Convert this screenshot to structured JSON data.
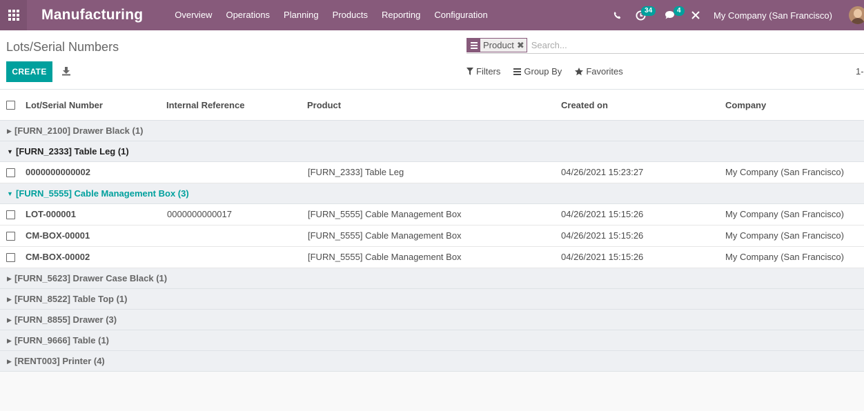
{
  "navbar": {
    "brand": "Manufacturing",
    "menu": [
      "Overview",
      "Operations",
      "Planning",
      "Products",
      "Reporting",
      "Configuration"
    ],
    "activity_count": "34",
    "message_count": "4",
    "company": "My Company (San Francisco)",
    "accent_color": "#875a7b"
  },
  "control": {
    "breadcrumb": "Lots/Serial Numbers",
    "create_label": "CREATE",
    "facet_label": "Product",
    "search_placeholder": "Search...",
    "filters_label": "Filters",
    "groupby_label": "Group By",
    "favorites_label": "Favorites",
    "pager": "1-"
  },
  "table": {
    "columns": [
      "Lot/Serial Number",
      "Internal Reference",
      "Product",
      "Created on",
      "Company"
    ],
    "groups": [
      {
        "label": "[FURN_2100] Drawer Black (1)",
        "state": "collapsed",
        "rows": []
      },
      {
        "label": "[FURN_2333] Table Leg (1)",
        "state": "open",
        "rows": [
          {
            "lot": "0000000000002",
            "ref": "",
            "product": "[FURN_2333] Table Leg",
            "created": "04/26/2021 15:23:27",
            "company": "My Company (San Francisco)"
          }
        ]
      },
      {
        "label": "[FURN_5555] Cable Management Box (3)",
        "state": "active",
        "rows": [
          {
            "lot": "LOT-000001",
            "ref": "0000000000017",
            "product": "[FURN_5555] Cable Management Box",
            "created": "04/26/2021 15:15:26",
            "company": "My Company (San Francisco)"
          },
          {
            "lot": "CM-BOX-00001",
            "ref": "",
            "product": "[FURN_5555] Cable Management Box",
            "created": "04/26/2021 15:15:26",
            "company": "My Company (San Francisco)"
          },
          {
            "lot": "CM-BOX-00002",
            "ref": "",
            "product": "[FURN_5555] Cable Management Box",
            "created": "04/26/2021 15:15:26",
            "company": "My Company (San Francisco)"
          }
        ]
      },
      {
        "label": "[FURN_5623] Drawer Case Black (1)",
        "state": "collapsed",
        "rows": []
      },
      {
        "label": "[FURN_8522] Table Top (1)",
        "state": "collapsed",
        "rows": []
      },
      {
        "label": "[FURN_8855] Drawer (3)",
        "state": "collapsed",
        "rows": []
      },
      {
        "label": "[FURN_9666] Table (1)",
        "state": "collapsed",
        "rows": []
      },
      {
        "label": "[RENT003] Printer (4)",
        "state": "collapsed",
        "rows": []
      }
    ]
  },
  "icons": {
    "apps": "apps-grid-icon",
    "phone": "phone-icon",
    "activity": "clock-icon",
    "messages": "chat-icon",
    "debug": "close-icon",
    "export": "download-icon",
    "filter": "funnel-icon",
    "groupby": "bars-icon",
    "favorites": "star-icon",
    "group_collapsed": "caret-right-icon",
    "group_open": "caret-down-icon"
  }
}
